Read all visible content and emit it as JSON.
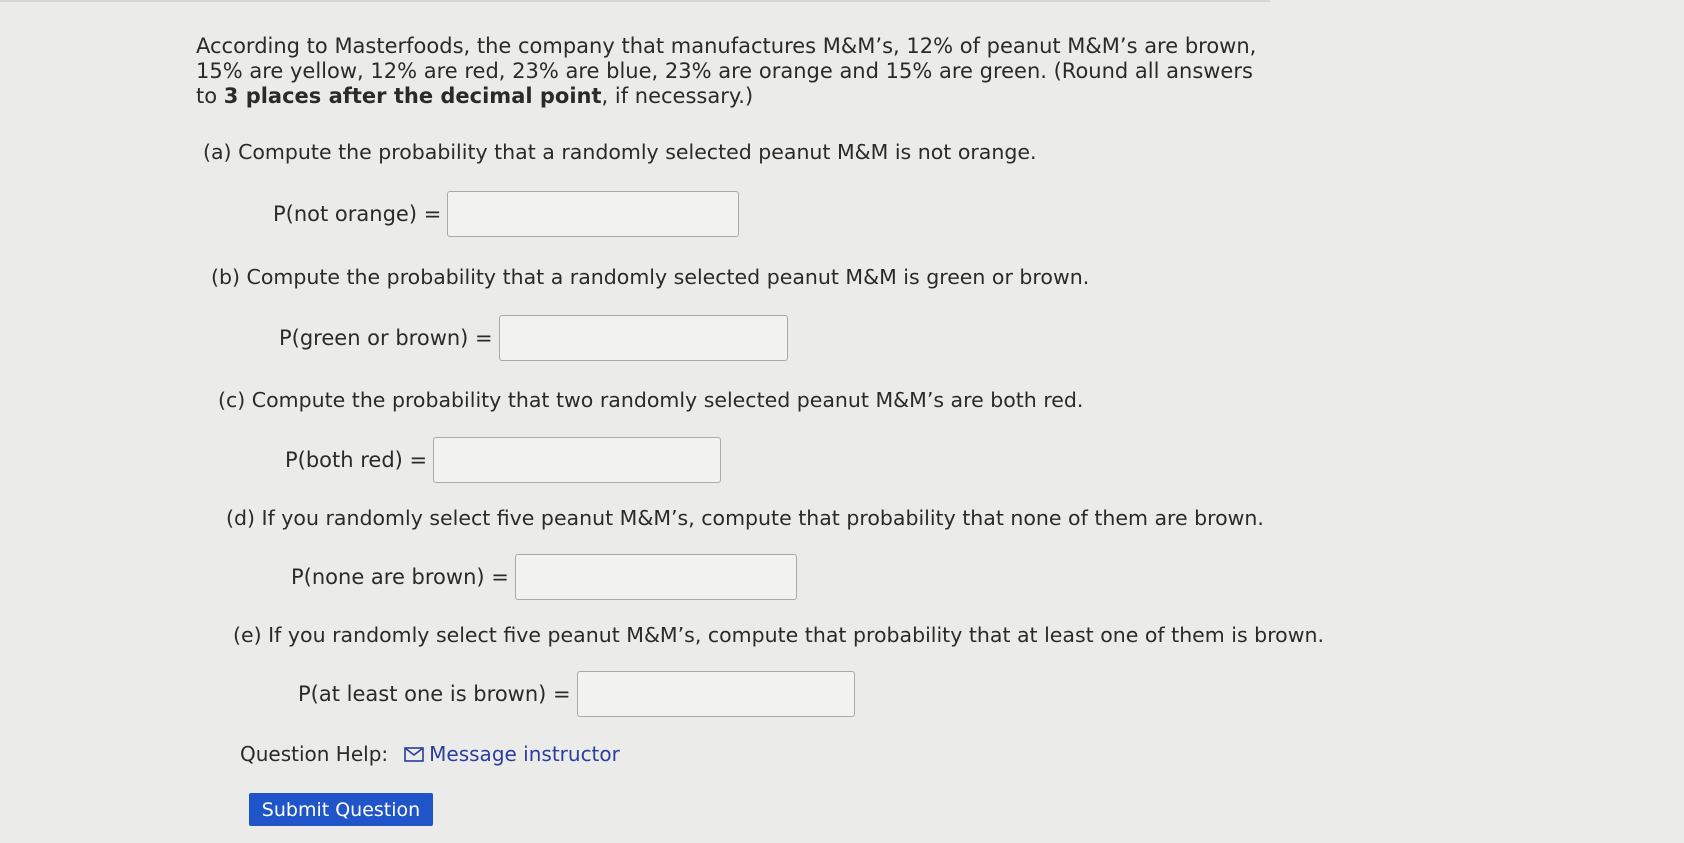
{
  "intro": {
    "part1": "According to Masterfoods, the company that manufactures M&M’s, 12% of peanut M&M’s are brown, 15% are yellow, 12% are red, 23% are blue, 23% are orange and 15% are green. (Round all answers to ",
    "bold": "3 places after the decimal point",
    "part2": ", if necessary.)"
  },
  "parts": [
    {
      "question": "(a) Compute the probability that a randomly selected peanut M&M is not orange.",
      "label": "P(not orange) =",
      "value": ""
    },
    {
      "question": "(b) Compute the probability that a randomly selected peanut M&M is green or brown.",
      "label": "P(green or brown) =",
      "value": ""
    },
    {
      "question": "(c) Compute the probability that two randomly selected peanut M&M’s are both red.",
      "label": "P(both red) =",
      "value": ""
    },
    {
      "question": "(d) If you randomly select five peanut M&M’s, compute that probability that none of them are brown.",
      "label": "P(none are brown) =",
      "value": ""
    },
    {
      "question": "(e) If you randomly select five peanut M&M’s, compute that probability that at least one of them is brown.",
      "label": "P(at least one is brown) =",
      "value": ""
    }
  ],
  "help": {
    "label": "Question Help:",
    "link_icon": "envelope-icon",
    "link_text": "Message instructor"
  },
  "submit_label": "Submit Question",
  "colors": {
    "background": "#ebebea",
    "link": "#2a3f9d",
    "button": "#1f55c9"
  }
}
